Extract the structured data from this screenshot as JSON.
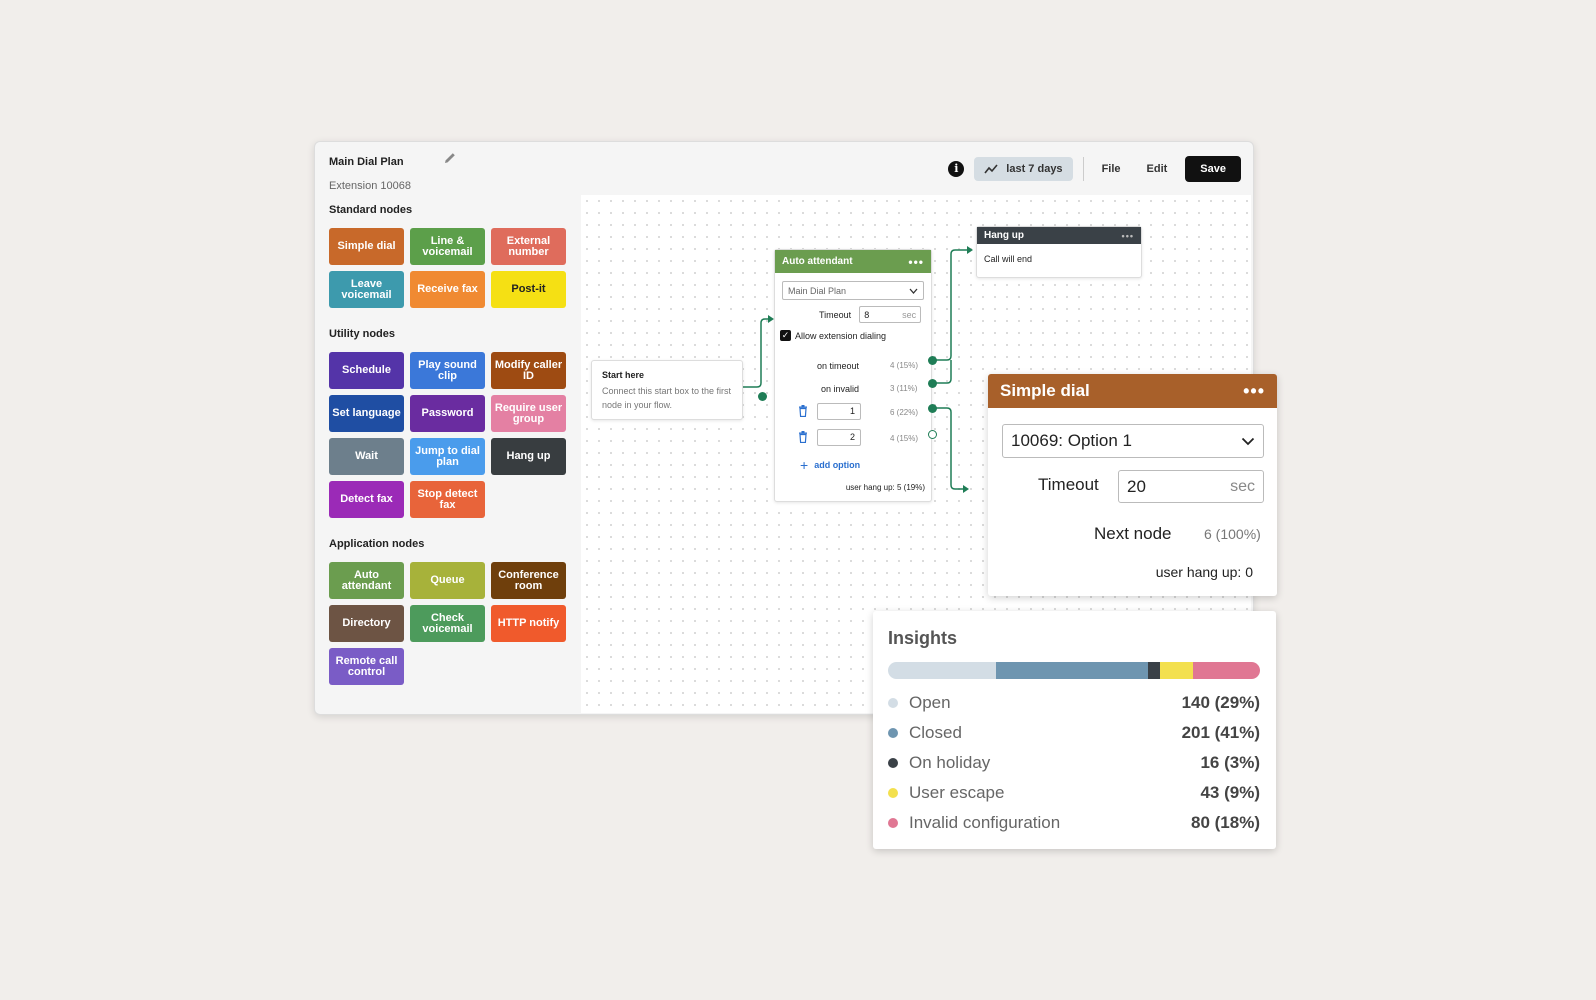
{
  "window": {
    "title": "Main Dial Plan",
    "subtitle": "Extension 10068"
  },
  "toolbar": {
    "range_label": "last 7 days",
    "file_label": "File",
    "edit_label": "Edit",
    "save_label": "Save"
  },
  "palette": {
    "standard": {
      "title": "Standard nodes",
      "nodes": [
        {
          "label": "Simple dial",
          "color": "#c8692a"
        },
        {
          "label": "Line & voicemail",
          "color": "#5c9f4a"
        },
        {
          "label": "External number",
          "color": "#df6c5c"
        },
        {
          "label": "Leave voicemail",
          "color": "#3d9aad"
        },
        {
          "label": "Receive fax",
          "color": "#f08a32"
        },
        {
          "label": "Post-it",
          "color": "#f5e014"
        }
      ]
    },
    "utility": {
      "title": "Utility nodes",
      "nodes": [
        {
          "label": "Schedule",
          "color": "#5434a8"
        },
        {
          "label": "Play sound clip",
          "color": "#3b78d9"
        },
        {
          "label": "Modify caller ID",
          "color": "#9e4b12"
        },
        {
          "label": "Set language",
          "color": "#1f4ea3"
        },
        {
          "label": "Password",
          "color": "#6a2ca0"
        },
        {
          "label": "Require user group",
          "color": "#e480a3"
        },
        {
          "label": "Wait",
          "color": "#6d7f8c"
        },
        {
          "label": "Jump to dial plan",
          "color": "#4a9cec"
        },
        {
          "label": "Hang up",
          "color": "#383d40"
        },
        {
          "label": "Detect fax",
          "color": "#9b2ab7"
        },
        {
          "label": "Stop detect fax",
          "color": "#e8643a"
        }
      ]
    },
    "application": {
      "title": "Application nodes",
      "nodes": [
        {
          "label": "Auto attendant",
          "color": "#6b9d4f"
        },
        {
          "label": "Queue",
          "color": "#a7b23a"
        },
        {
          "label": "Conference room",
          "color": "#6f3f0c"
        },
        {
          "label": "Directory",
          "color": "#6d5444"
        },
        {
          "label": "Check voicemail",
          "color": "#4d9b5c"
        },
        {
          "label": "HTTP notify",
          "color": "#f05a2c"
        },
        {
          "label": "Remote call control",
          "color": "#7a5cc6"
        }
      ]
    }
  },
  "canvas": {
    "start": {
      "title": "Start here",
      "description": "Connect this start box to the first node in your flow."
    },
    "auto_attendant": {
      "title": "Auto attendant",
      "dial_plan": "Main Dial Plan",
      "timeout_label": "Timeout",
      "timeout_value": "8",
      "unit": "sec",
      "allow_label": "Allow extension dialing",
      "on_timeout_label": "on timeout",
      "on_timeout_stat": "4 (15%)",
      "on_invalid_label": "on invalid",
      "on_invalid_stat": "3 (11%)",
      "option1_value": "1",
      "option1_stat": "6 (22%)",
      "option2_value": "2",
      "option2_stat": "4 (15%)",
      "add_option_label": "add option",
      "hangup_stat": "user hang up: 5 (19%)"
    },
    "hangup": {
      "title": "Hang up",
      "body": "Call will end"
    }
  },
  "simple_dial": {
    "title": "Simple dial",
    "option": "10069: Option 1",
    "timeout_label": "Timeout",
    "timeout_value": "20",
    "unit": "sec",
    "next_label": "Next node",
    "next_stat": "6 (100%)",
    "hangup_stat": "user hang up: 0"
  },
  "insights": {
    "title": "Insights",
    "items": [
      {
        "label": "Open",
        "value": "140 (29%)",
        "color": "#d3dde5",
        "share": 29
      },
      {
        "label": "Closed",
        "value": "201 (41%)",
        "color": "#6e95b0",
        "share": 41
      },
      {
        "label": "On holiday",
        "value": "16 (3%)",
        "color": "#3a4147",
        "share": 3
      },
      {
        "label": "User escape",
        "value": "43 (9%)",
        "color": "#f3e04e",
        "share": 9
      },
      {
        "label": "Invalid configuration",
        "value": "80 (18%)",
        "color": "#e07793",
        "share": 18
      }
    ]
  }
}
